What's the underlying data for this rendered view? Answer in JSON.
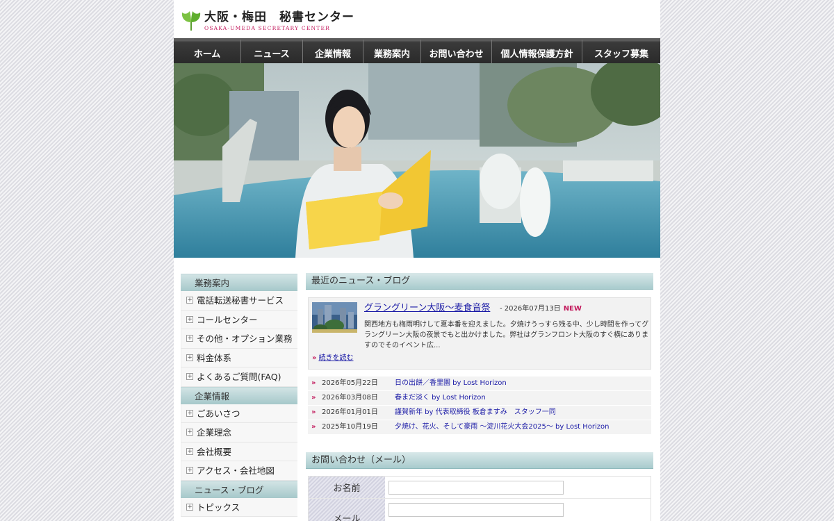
{
  "logo": {
    "title_jp": "大阪・梅田　秘書センター",
    "title_en": "OSAKA-UMEDA SECRETARY CENTER"
  },
  "nav": {
    "items": [
      "ホーム",
      "ニュース",
      "企業情報",
      "業務案内",
      "お問い合わせ",
      "個人情報保護方針",
      "スタッフ募集"
    ]
  },
  "sidebar": {
    "groups": [
      {
        "heading": "業務案内",
        "items": [
          "電話転送秘書サービス",
          "コールセンター",
          "その他・オプション業務",
          "料金体系",
          "よくあるご質問(FAQ)"
        ]
      },
      {
        "heading": "企業情報",
        "items": [
          "ごあいさつ",
          "企業理念",
          "会社概要",
          "アクセス・会社地図"
        ]
      },
      {
        "heading": "ニュース・ブログ",
        "items": [
          "トピックス"
        ]
      }
    ]
  },
  "news": {
    "heading": "最近のニュース・ブログ",
    "feature": {
      "title": "グラングリーン大阪～麦食音祭",
      "date": "- 2026年07月13日",
      "badge": "NEW",
      "body": "関西地方も梅雨明けして夏本番を迎えました。夕焼けうっすら残る中、少し時間を作ってグラングリーン大阪の夜景でもと出かけました。弊社はグランフロント大阪のすぐ横にありますのでそのイベント広...",
      "more": "続きを読む"
    },
    "list": [
      {
        "date": "2026年05月22日",
        "title": "日の出餅／香里園 by Lost Horizon"
      },
      {
        "date": "2026年03月08日",
        "title": "春まだ淡く by Lost Horizon"
      },
      {
        "date": "2026年01月01日",
        "title": "謹賀新年 by 代表取締役 板倉ますみ　スタッフ一同"
      },
      {
        "date": "2025年10月19日",
        "title": "夕焼け、花火、そして豪雨 ～淀川花火大会2025～ by Lost Horizon"
      }
    ]
  },
  "contact": {
    "heading": "お問い合わせ（メール）",
    "fields": [
      {
        "label": "お名前",
        "value": ""
      },
      {
        "label": "メール",
        "value": ""
      }
    ]
  },
  "colors": {
    "accent": "#c2185b",
    "link": "#1a1aa6",
    "section_head": "#a8cbcd",
    "nav_bg": "#2a2a2a"
  }
}
